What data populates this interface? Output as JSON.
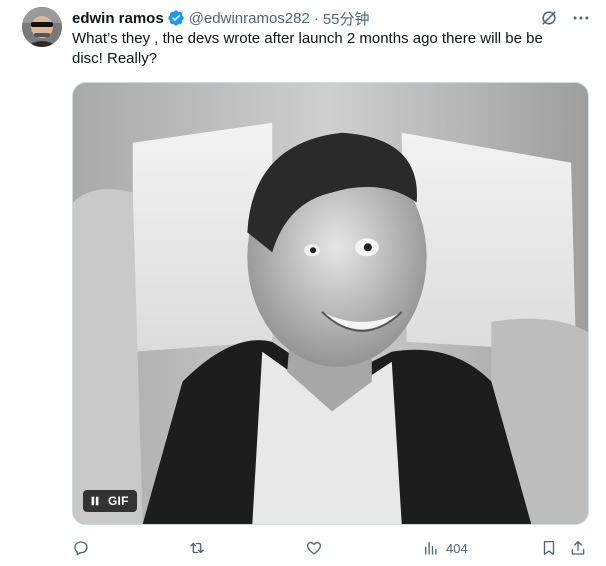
{
  "tweet": {
    "author": {
      "display_name": "edwin ramos",
      "handle": "@edwinramos282",
      "verified": true,
      "avatar_icon": "avatar-photo"
    },
    "separator": "·",
    "time": "55分钟",
    "text": "What’s they , the devs wrote after launch 2 months ago there will be be disc! Really?",
    "media": {
      "type": "gif",
      "badge": "GIF",
      "pause_icon": "pause-icon"
    },
    "actions": {
      "reply_icon": "reply-icon",
      "retweet_icon": "retweet-icon",
      "like_icon": "heart-icon",
      "views_icon": "views-icon",
      "views_count": "404",
      "bookmark_icon": "bookmark-icon",
      "share_icon": "share-icon"
    },
    "top_actions": {
      "grok_icon": "grok-icon",
      "more_icon": "more-icon"
    }
  },
  "colors": {
    "text_primary": "#0f1419",
    "text_secondary": "#536471",
    "verified_blue": "#1d9bf0",
    "border": "#cfd9de"
  }
}
